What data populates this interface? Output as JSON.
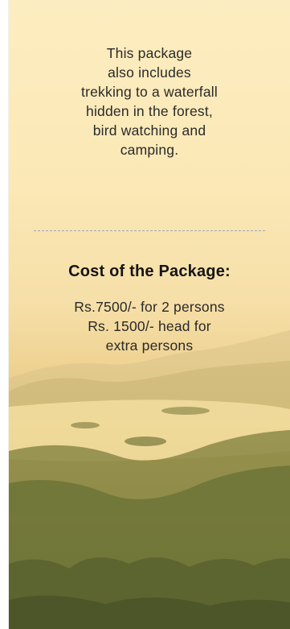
{
  "package": {
    "intro_lines": [
      "This package",
      "also includes",
      "trekking to a waterfall",
      "hidden in the forest,",
      "bird watching and",
      "camping."
    ],
    "cost_title": "Cost of the Package:",
    "cost_lines": [
      "Rs.7500/- for 2 persons",
      "Rs. 1500/- head for",
      "extra persons"
    ]
  },
  "background": {
    "image": "misty-hills-lake-landscape",
    "top_color": "#fcedc0",
    "bottom_color": "#6f7838"
  }
}
